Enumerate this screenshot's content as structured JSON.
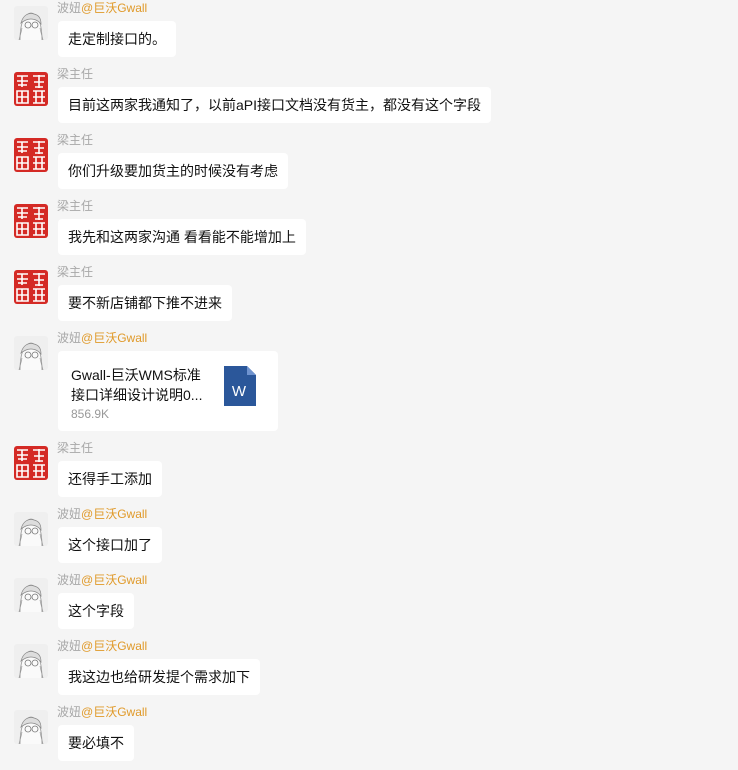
{
  "messages": [
    {
      "sender": "波妞",
      "mention": "@巨沃Gwall",
      "avatar": "sketch-avatar",
      "text": "走定制接口的。"
    },
    {
      "sender": "梁主任",
      "mention": "",
      "avatar": "red-seal-avatar",
      "text": "目前这两家我通知了，以前aPI接口文档没有货主，都没有这个字段"
    },
    {
      "sender": "梁主任",
      "mention": "",
      "avatar": "red-seal-avatar",
      "text": "你们升级要加货主的时候没有考虑"
    },
    {
      "sender": "梁主任",
      "mention": "",
      "avatar": "red-seal-avatar",
      "text": "我先和这两家沟通 看看能不能增加上"
    },
    {
      "sender": "梁主任",
      "mention": "",
      "avatar": "red-seal-avatar",
      "text": "要不新店铺都下推不进来"
    },
    {
      "sender": "波妞",
      "mention": "@巨沃Gwall",
      "avatar": "sketch-avatar",
      "file": {
        "name": "Gwall-巨沃WMS标准\n接口详细设计说明0...",
        "size": "856.9K",
        "icon": "word-icon",
        "icon_letter": "W"
      }
    },
    {
      "sender": "梁主任",
      "mention": "",
      "avatar": "red-seal-avatar",
      "text": "还得手工添加"
    },
    {
      "sender": "波妞",
      "mention": "@巨沃Gwall",
      "avatar": "sketch-avatar",
      "text": "这个接口加了"
    },
    {
      "sender": "波妞",
      "mention": "@巨沃Gwall",
      "avatar": "sketch-avatar",
      "text": "这个字段"
    },
    {
      "sender": "波妞",
      "mention": "@巨沃Gwall",
      "avatar": "sketch-avatar",
      "text": "我这边也给研发提个需求加下"
    },
    {
      "sender": "波妞",
      "mention": "@巨沃Gwall",
      "avatar": "sketch-avatar",
      "text": "要必填不"
    }
  ],
  "colors": {
    "background": "#f5f5f5",
    "bubble": "#ffffff",
    "name": "#a8a8a8",
    "mention": "#e09a2a",
    "seal": "#d42a25",
    "word": "#2b579a"
  }
}
